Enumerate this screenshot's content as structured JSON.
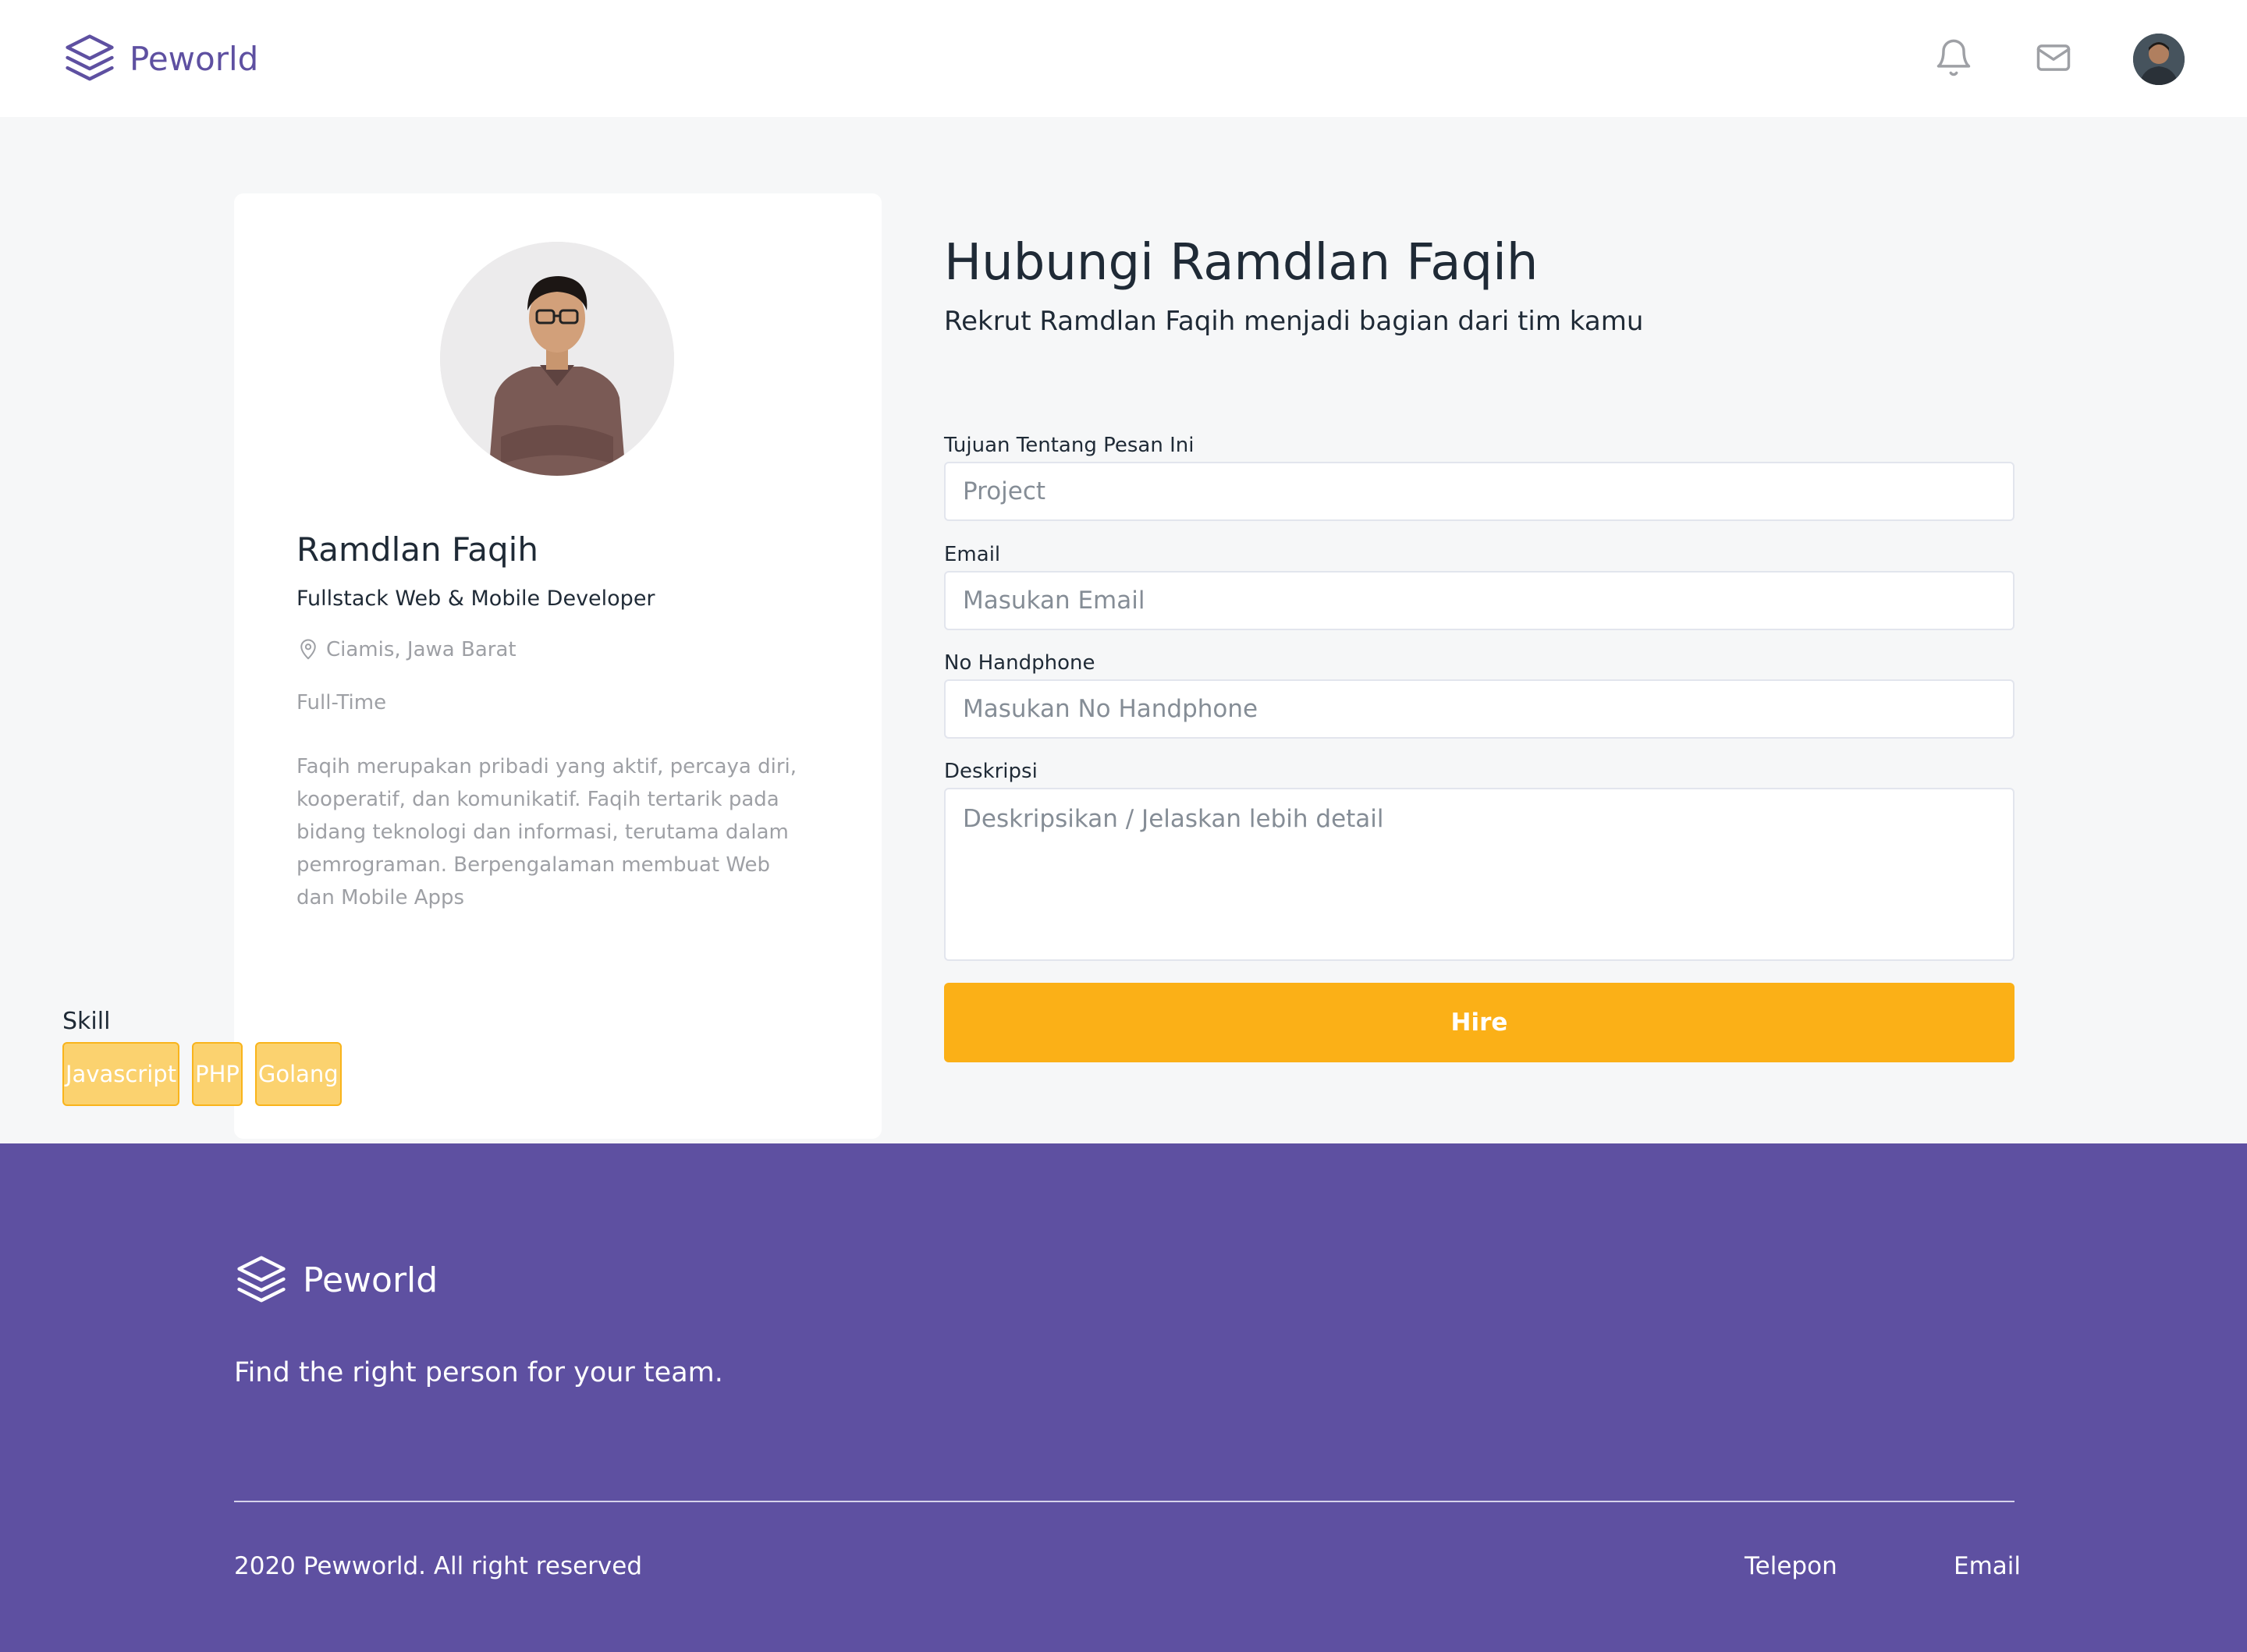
{
  "brand": {
    "name": "Peworld",
    "color": "#5E50A1"
  },
  "navbar": {
    "icons": [
      "bell-icon",
      "mail-icon"
    ],
    "avatar": "user-avatar"
  },
  "profile": {
    "name": "Ramdlan Faqih",
    "role": "Fullstack Web & Mobile Developer",
    "location": "Ciamis, Jawa Barat",
    "job_type": "Full-Time",
    "description": "Faqih merupakan pribadi yang aktif, percaya diri, kooperatif, dan komunikatif. Faqih tertarik pada bidang teknologi dan informasi, terutama dalam pemrograman. Berpengalaman membuat Web dan Mobile Apps",
    "skill_title": "Skill",
    "skills": [
      "Javascript",
      "PHP",
      "Golang"
    ]
  },
  "contact": {
    "title": "Hubungi Ramdlan Faqih",
    "subtitle": "Rekrut Ramdlan Faqih menjadi bagian dari tim kamu",
    "fields": {
      "purpose": {
        "label": "Tujuan Tentang Pesan Ini",
        "placeholder": "Project"
      },
      "email": {
        "label": "Email",
        "placeholder": "Masukan Email"
      },
      "phone": {
        "label": "No Handphone",
        "placeholder": "Masukan No Handphone"
      },
      "description": {
        "label": "Deskripsi",
        "placeholder": "Deskripsikan / Jelaskan lebih detail"
      }
    },
    "submit_label": "Hire",
    "accent_color": "#FBB017"
  },
  "footer": {
    "brand_name": "Peworld",
    "tagline": "Find the right person for your team.",
    "copyright": "2020 Pewworld. All right reserved",
    "links": [
      "Telepon",
      "Email"
    ],
    "background": "#5E50A1"
  }
}
